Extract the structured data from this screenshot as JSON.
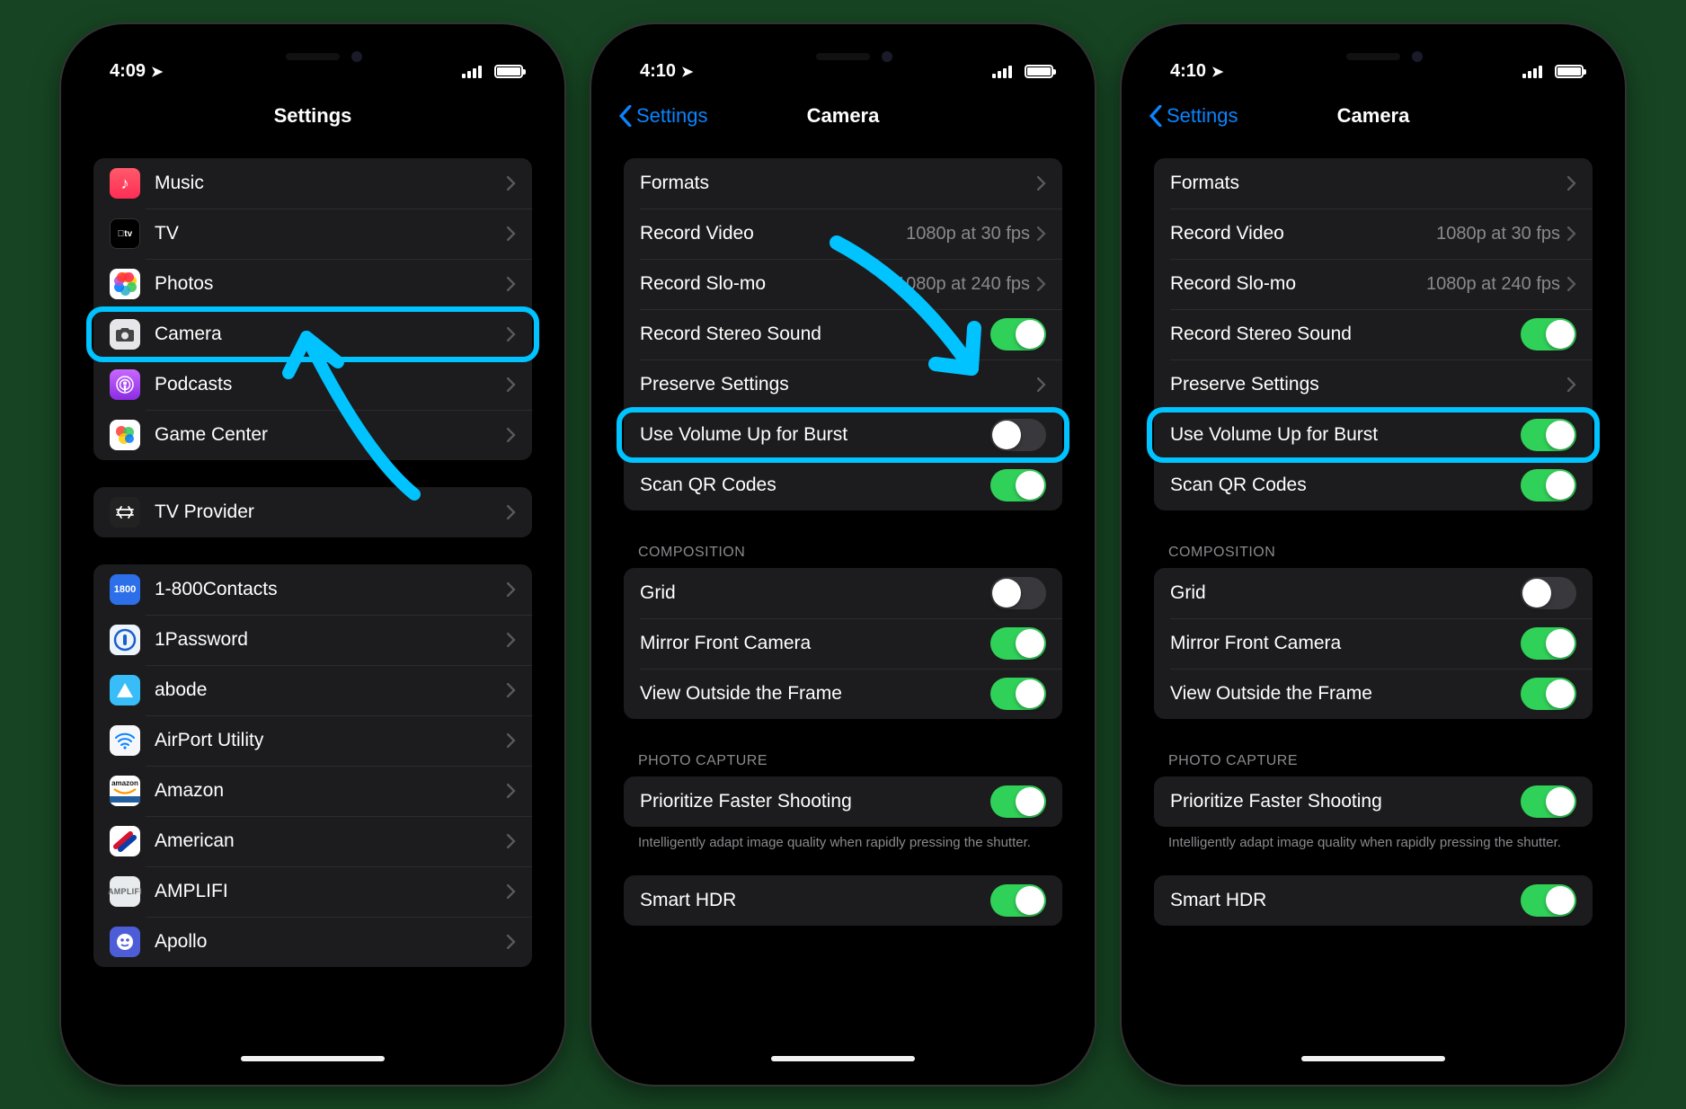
{
  "status": {
    "time1": "4:09",
    "time2": "4:10",
    "time3": "4:10"
  },
  "screen1": {
    "title": "Settings",
    "groups": [
      {
        "rows": [
          {
            "id": "music",
            "label": "Music"
          },
          {
            "id": "tv",
            "label": "TV"
          },
          {
            "id": "photos",
            "label": "Photos"
          },
          {
            "id": "camera",
            "label": "Camera",
            "highlight": true
          },
          {
            "id": "podcasts",
            "label": "Podcasts"
          },
          {
            "id": "gc",
            "label": "Game Center"
          }
        ]
      },
      {
        "rows": [
          {
            "id": "tvp",
            "label": "TV Provider"
          }
        ]
      },
      {
        "rows": [
          {
            "id": "1800",
            "label": "1-800Contacts"
          },
          {
            "id": "1pw",
            "label": "1Password"
          },
          {
            "id": "abode",
            "label": "abode"
          },
          {
            "id": "airport",
            "label": "AirPort Utility"
          },
          {
            "id": "amazon",
            "label": "Amazon"
          },
          {
            "id": "american",
            "label": "American"
          },
          {
            "id": "amplifi",
            "label": "AMPLIFI"
          },
          {
            "id": "apollo",
            "label": "Apollo"
          }
        ]
      }
    ]
  },
  "camera": {
    "back": "Settings",
    "title": "Camera",
    "rows": {
      "formats": "Formats",
      "record_video": "Record Video",
      "record_video_detail": "1080p at 30 fps",
      "record_slomo": "Record Slo-mo",
      "record_slomo_detail": "1080p at 240 fps",
      "stereo": "Record Stereo Sound",
      "preserve": "Preserve Settings",
      "burst": "Use Volume Up for Burst",
      "qr": "Scan QR Codes"
    },
    "composition_header": "COMPOSITION",
    "comp": {
      "grid": "Grid",
      "mirror": "Mirror Front Camera",
      "outside": "View Outside the Frame"
    },
    "photo_header": "PHOTO CAPTURE",
    "photo": {
      "prioritize": "Prioritize Faster Shooting",
      "footer": "Intelligently adapt image quality when rapidly pressing the shutter."
    },
    "smarthdr": "Smart HDR"
  },
  "toggles2": {
    "stereo": true,
    "burst": false,
    "qr": true,
    "grid": false,
    "mirror": true,
    "outside": true,
    "prioritize": true,
    "smarthdr": true
  },
  "toggles3": {
    "stereo": true,
    "burst": true,
    "qr": true,
    "grid": false,
    "mirror": true,
    "outside": true,
    "prioritize": true,
    "smarthdr": true
  }
}
